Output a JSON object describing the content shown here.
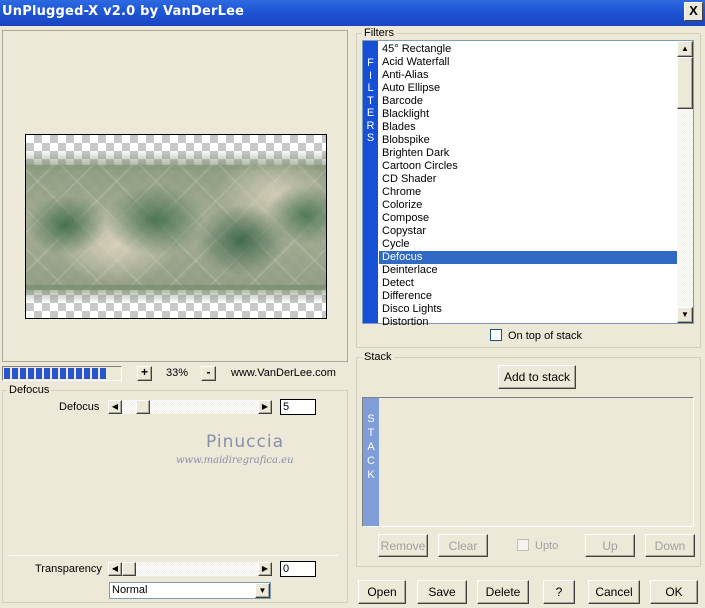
{
  "window": {
    "title": "UnPlugged-X v2.0 by VanDerLee",
    "close_glyph": "X"
  },
  "preview": {
    "zoom": "33%",
    "zoom_in": "+",
    "zoom_out": "-",
    "website": "www.VanDerLee.com",
    "progress_segments": 13
  },
  "filters": {
    "label": "Filters",
    "tab_letters": [
      "F",
      "I",
      "L",
      "T",
      "E",
      "R",
      "S"
    ],
    "items": [
      "45° Rectangle",
      "Acid Waterfall",
      "Anti-Alias",
      "Auto Ellipse",
      "Barcode",
      "Blacklight",
      "Blades",
      "Blobspike",
      "Brighten Dark",
      "Cartoon Circles",
      "CD Shader",
      "Chrome",
      "Colorize",
      "Compose",
      "Copystar",
      "Cycle",
      "Defocus",
      "Deinterlace",
      "Detect",
      "Difference",
      "Disco Lights",
      "Distortion"
    ],
    "selected": "Defocus",
    "on_top_label": "On top of stack"
  },
  "defocus": {
    "group_label": "Defocus",
    "param_label": "Defocus",
    "param_value": "5"
  },
  "watermark": {
    "line1": "Pinuccia",
    "line2": "www.maidiregrafica.eu"
  },
  "bottom": {
    "transparency_label": "Transparency",
    "transparency_value": "0",
    "blend_mode": "Normal"
  },
  "stack": {
    "label": "Stack",
    "add_button": "Add to stack",
    "tab_letters": [
      "S",
      "T",
      "A",
      "C",
      "K"
    ],
    "remove": "Remove",
    "clear": "Clear",
    "upto": "Upto",
    "up": "Up",
    "down": "Down"
  },
  "footer": {
    "open": "Open",
    "save": "Save",
    "delete": "Delete",
    "help": "?",
    "cancel": "Cancel",
    "ok": "OK"
  }
}
